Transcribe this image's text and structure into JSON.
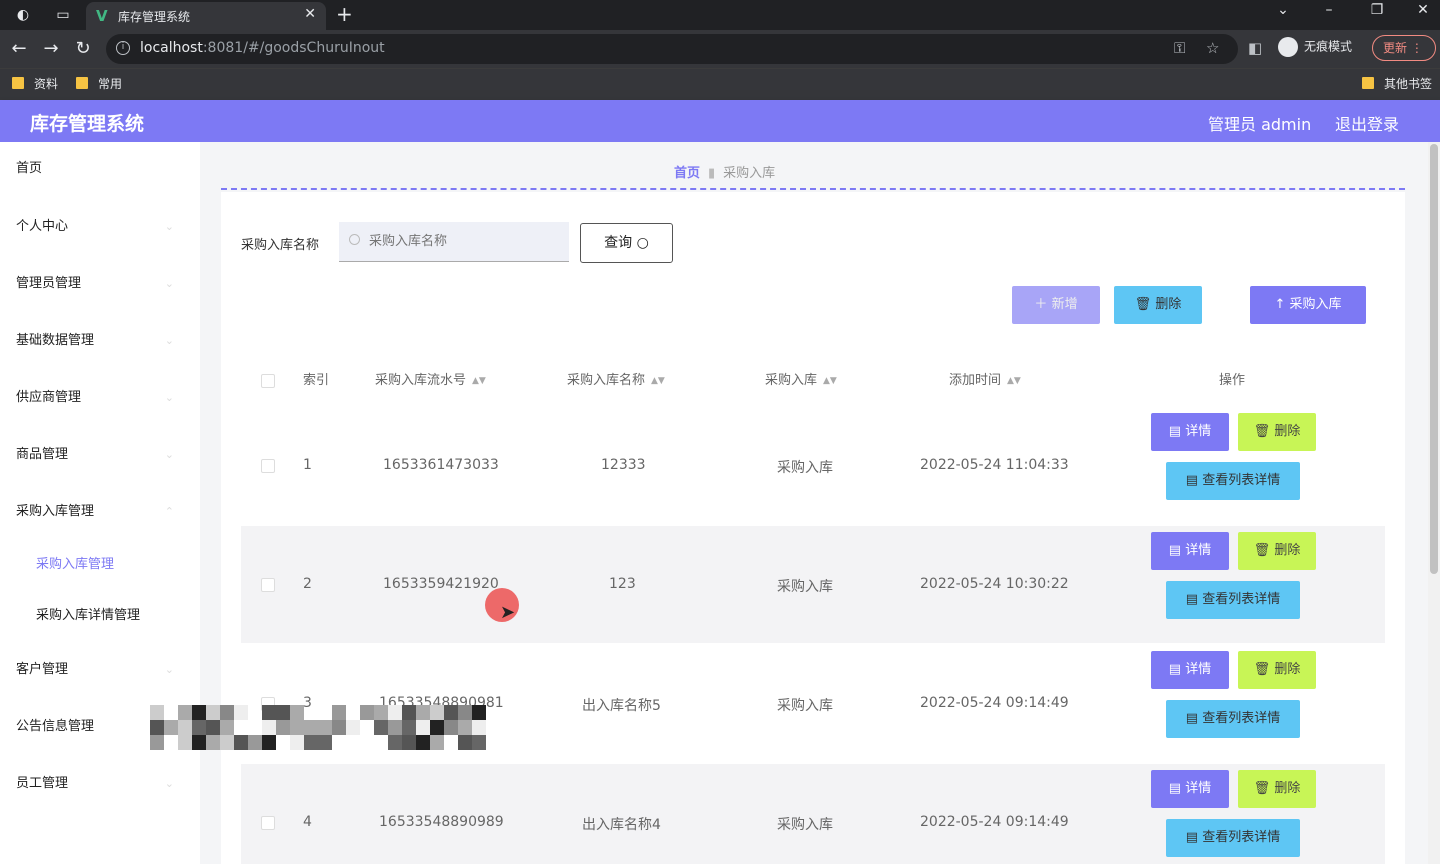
{
  "browser": {
    "tab_title": "库存管理系统",
    "url_host": "localhost",
    "url_rest": ":8081/#/goodsChuruInout",
    "incognito_label": "无痕模式",
    "update_label": "更新",
    "bookmarks": [
      "资料",
      "常用"
    ],
    "other_bookmarks": "其他书签"
  },
  "header": {
    "title": "库存管理系统",
    "user": "管理员 admin",
    "logout": "退出登录"
  },
  "sidebar": {
    "items": [
      "首页",
      "个人中心",
      "管理员管理",
      "基础数据管理",
      "供应商管理",
      "商品管理",
      "采购入库管理"
    ],
    "subitems": [
      "采购入库管理",
      "采购入库详情管理"
    ],
    "items_after": [
      "客户管理",
      "公告信息管理",
      "员工管理"
    ]
  },
  "breadcrumb": {
    "home": "首页",
    "current": "采购入库"
  },
  "search": {
    "label": "采购入库名称",
    "placeholder": "采购入库名称",
    "button": "查询"
  },
  "actions": {
    "add": "新增",
    "delete": "删除",
    "purchase": "采购入库"
  },
  "table": {
    "headers": [
      "索引",
      "采购入库流水号",
      "采购入库名称",
      "采购入库",
      "添加时间",
      "操作"
    ],
    "rows": [
      {
        "index": "1",
        "serial": "1653361473033",
        "name": "12333",
        "type": "采购入库",
        "time": "2022-05-24 11:04:33"
      },
      {
        "index": "2",
        "serial": "1653359421920",
        "name": "123",
        "type": "采购入库",
        "time": "2022-05-24 10:30:22"
      },
      {
        "index": "3",
        "serial": "16533548890981",
        "name": "出入库名称5",
        "type": "采购入库",
        "time": "2022-05-24 09:14:49"
      },
      {
        "index": "4",
        "serial": "16533548890989",
        "name": "出入库名称4",
        "type": "采购入库",
        "time": "2022-05-24 09:14:49"
      }
    ],
    "op_detail": "详情",
    "op_delete": "删除",
    "op_list": "查看列表详情"
  },
  "colors": {
    "accent": "#7d79f4",
    "info": "#5ec6f4",
    "warn": "#c8f556"
  }
}
